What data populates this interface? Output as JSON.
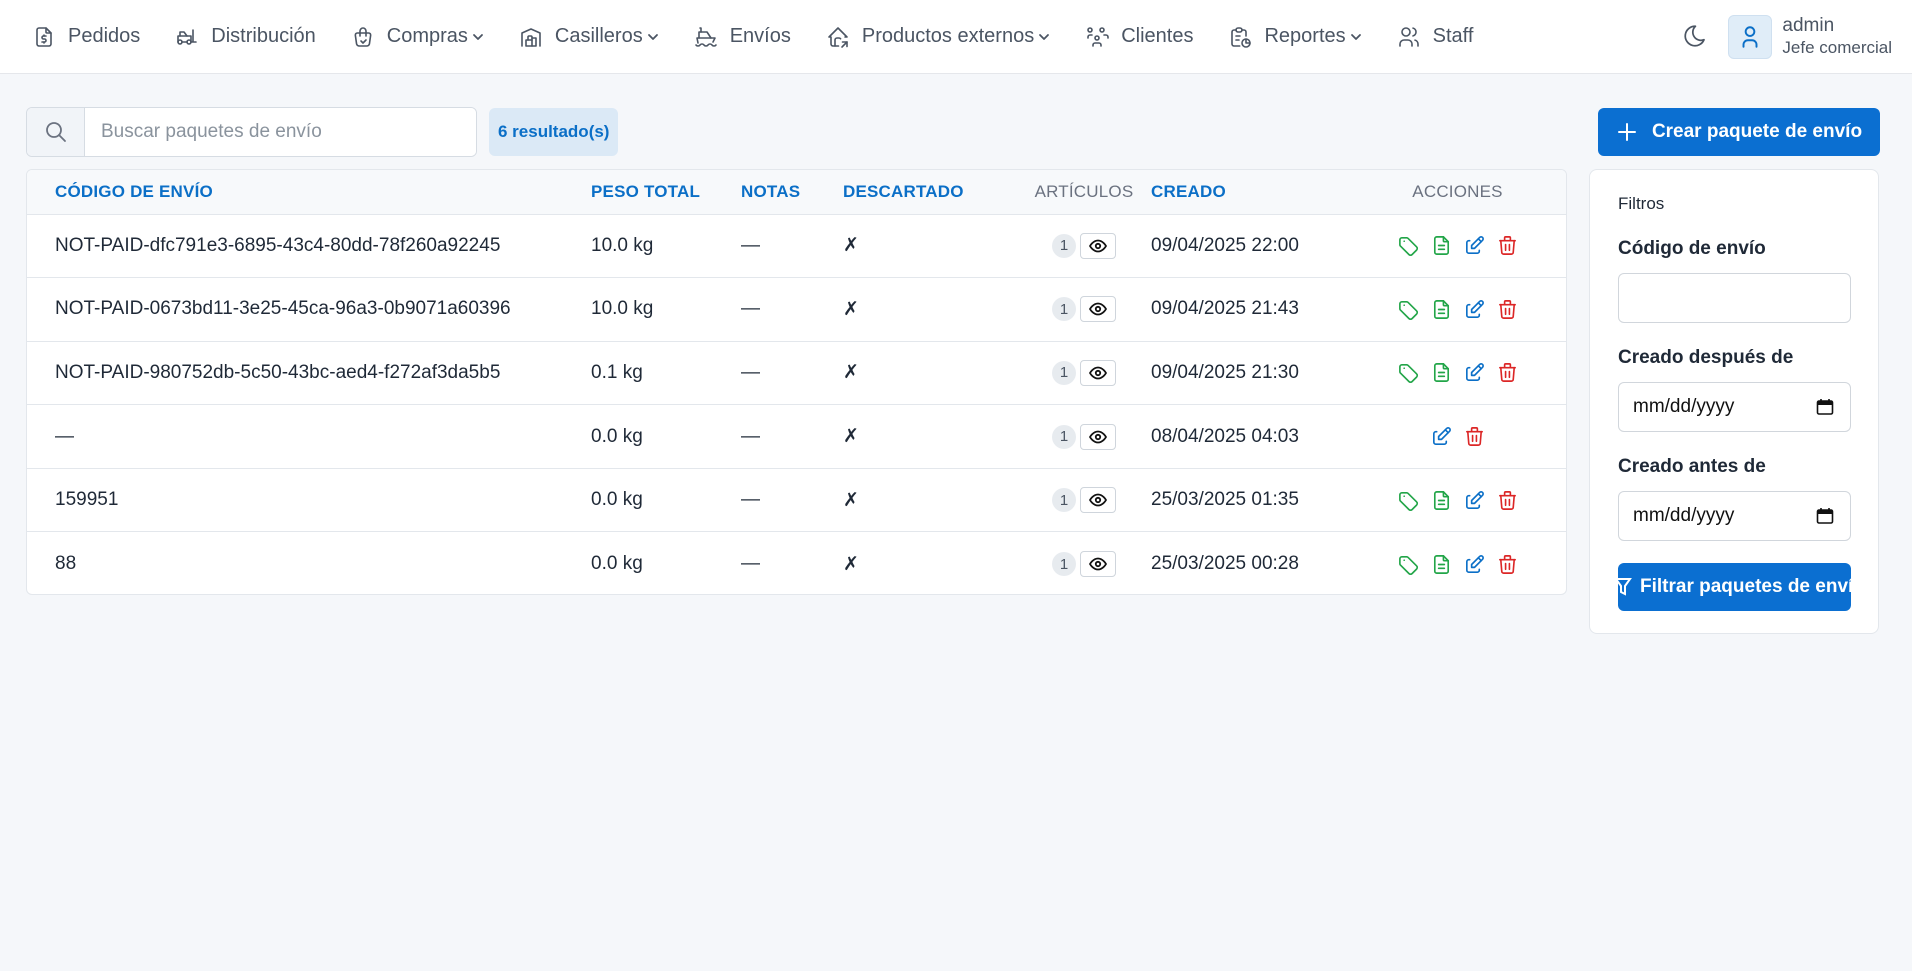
{
  "nav": {
    "items": [
      {
        "label": "Pedidos",
        "icon": "file-dollar-icon",
        "has_dropdown": false
      },
      {
        "label": "Distribución",
        "icon": "forklift-icon",
        "has_dropdown": false
      },
      {
        "label": "Compras",
        "icon": "shopping-bag-icon",
        "has_dropdown": true
      },
      {
        "label": "Casilleros",
        "icon": "warehouse-icon",
        "has_dropdown": true
      },
      {
        "label": "Envíos",
        "icon": "ship-icon",
        "has_dropdown": false
      },
      {
        "label": "Productos externos",
        "icon": "home-share-icon",
        "has_dropdown": true
      },
      {
        "label": "Clientes",
        "icon": "users-group-icon",
        "has_dropdown": false
      },
      {
        "label": "Reportes",
        "icon": "report-clock-icon",
        "has_dropdown": true
      },
      {
        "label": "Staff",
        "icon": "users-icon",
        "has_dropdown": false
      }
    ],
    "user": {
      "name": "admin",
      "role": "Jefe comercial"
    }
  },
  "search": {
    "placeholder": "Buscar paquetes de envío",
    "value": ""
  },
  "results_badge": "6 resultado(s)",
  "create_button": "Crear paquete de envío",
  "table": {
    "headers": {
      "code": "CÓDIGO DE ENVÍO",
      "weight": "PESO TOTAL",
      "notes": "NOTAS",
      "discarded": "DESCARTADO",
      "articles": "ARTÍCULOS",
      "created": "CREADO",
      "actions": "ACCIONES"
    },
    "rows": [
      {
        "code": "NOT-PAID-dfc791e3-6895-43c4-80dd-78f260a92245",
        "weight": "10.0 kg",
        "notes": "—",
        "discarded": "✗",
        "articles": "1",
        "created": "09/04/2025 22:00",
        "full_actions": true
      },
      {
        "code": "NOT-PAID-0673bd11-3e25-45ca-96a3-0b9071a60396",
        "weight": "10.0 kg",
        "notes": "—",
        "discarded": "✗",
        "articles": "1",
        "created": "09/04/2025 21:43",
        "full_actions": true
      },
      {
        "code": "NOT-PAID-980752db-5c50-43bc-aed4-f272af3da5b5",
        "weight": "0.1 kg",
        "notes": "—",
        "discarded": "✗",
        "articles": "1",
        "created": "09/04/2025 21:30",
        "full_actions": true
      },
      {
        "code": "—",
        "weight": "0.0 kg",
        "notes": "—",
        "discarded": "✗",
        "articles": "1",
        "created": "08/04/2025 04:03",
        "full_actions": false
      },
      {
        "code": "159951",
        "weight": "0.0 kg",
        "notes": "—",
        "discarded": "✗",
        "articles": "1",
        "created": "25/03/2025 01:35",
        "full_actions": true
      },
      {
        "code": "88",
        "weight": "0.0 kg",
        "notes": "—",
        "discarded": "✗",
        "articles": "1",
        "created": "25/03/2025 00:28",
        "full_actions": true
      }
    ]
  },
  "filters": {
    "title": "Filtros",
    "code_label": "Código de envío",
    "code_value": "",
    "after_label": "Creado después de",
    "after_placeholder": "mm/dd/yyyy",
    "before_label": "Creado antes de",
    "before_placeholder": "mm/dd/yyyy",
    "button": "Filtrar paquetes de envío"
  },
  "colors": {
    "primary": "#0b6fd1",
    "action_green": "#22a548",
    "action_blue": "#0b6fc7",
    "action_red": "#dc2626"
  }
}
